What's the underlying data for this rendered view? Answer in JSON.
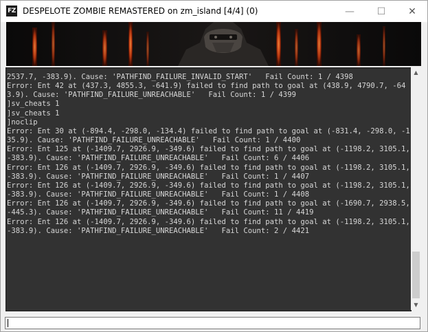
{
  "window": {
    "title": "DESPELOTE ZOMBIE REMASTERED on zm_island [4/4] (0)",
    "icon_label": "FZ"
  },
  "titlebar_buttons": {
    "minimize": "—",
    "maximize": "☐",
    "close": "✕"
  },
  "console": {
    "lines": [
      "2537.7, -383.9). Cause: 'PATHFIND_FAILURE_INVALID_START'   Fail Count: 1 / 4398",
      "Error: Ent 42 at (437.3, 4855.3, -641.9) failed to find path to goal at (438.9, 4790.7, -643.9). Cause: 'PATHFIND_FAILURE_UNREACHABLE'   Fail Count: 1 / 4399",
      "]sv_cheats 1",
      "]sv_cheats 1",
      "]noclip",
      "Error: Ent 30 at (-894.4, -298.0, -134.4) failed to find path to goal at (-831.4, -298.0, -135.9). Cause: 'PATHFIND_FAILURE_UNREACHABLE'   Fail Count: 1 / 4400",
      "Error: Ent 125 at (-1409.7, 2926.9, -349.6) failed to find path to goal at (-1198.2, 3105.1, -383.9). Cause: 'PATHFIND_FAILURE_UNREACHABLE'   Fail Count: 6 / 4406",
      "Error: Ent 126 at (-1409.7, 2926.9, -349.6) failed to find path to goal at (-1198.2, 3105.1, -383.9). Cause: 'PATHFIND_FAILURE_UNREACHABLE'   Fail Count: 1 / 4407",
      "Error: Ent 126 at (-1409.7, 2926.9, -349.6) failed to find path to goal at (-1198.2, 3105.1, -383.9). Cause: 'PATHFIND_FAILURE_UNREACHABLE'   Fail Count: 1 / 4408",
      "Error: Ent 126 at (-1409.7, 2926.9, -349.6) failed to find path to goal at (-1690.7, 2938.5, -445.3). Cause: 'PATHFIND_FAILURE_UNREACHABLE'   Fail Count: 11 / 4419",
      "Error: Ent 126 at (-1409.7, 2926.9, -349.6) failed to find path to goal at (-1198.2, 3105.1, -383.9). Cause: 'PATHFIND_FAILURE_UNREACHABLE'   Fail Count: 2 / 4421"
    ],
    "background_color": "#323232",
    "text_color": "#d6d6d6"
  },
  "scrollbar": {
    "up_arrow_icon": "chevron-up-icon",
    "down_arrow_icon": "chevron-down-icon",
    "position_fraction": 0.87
  },
  "command_input": {
    "value": ""
  }
}
